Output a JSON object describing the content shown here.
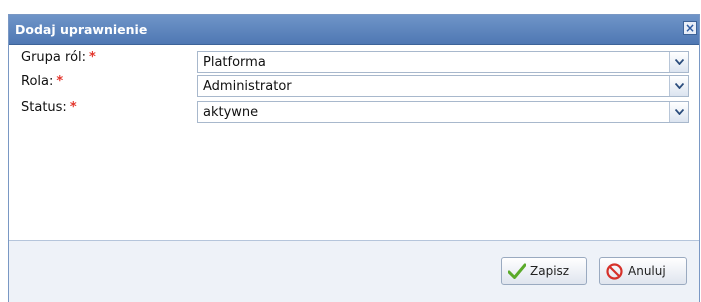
{
  "dialog": {
    "title": "Dodaj uprawnienie",
    "close_icon": "×"
  },
  "form": {
    "required_marker": "*",
    "fields": [
      {
        "label": "Grupa ról:",
        "value": "Platforma"
      },
      {
        "label": "Rola:",
        "value": "Administrator"
      },
      {
        "label": "Status:",
        "value": "aktywne"
      }
    ]
  },
  "footer": {
    "save_label": "Zapisz",
    "cancel_label": "Anuluj"
  },
  "colors": {
    "titlebar": "#4f78b3",
    "required": "#e3362d",
    "save_check": "#5aaa2a",
    "cancel_icon": "#d6312a"
  },
  "icons": {
    "close": "close-icon",
    "dropdown": "chevron-down-icon",
    "save": "checkmark-icon",
    "cancel": "no-entry-icon"
  }
}
